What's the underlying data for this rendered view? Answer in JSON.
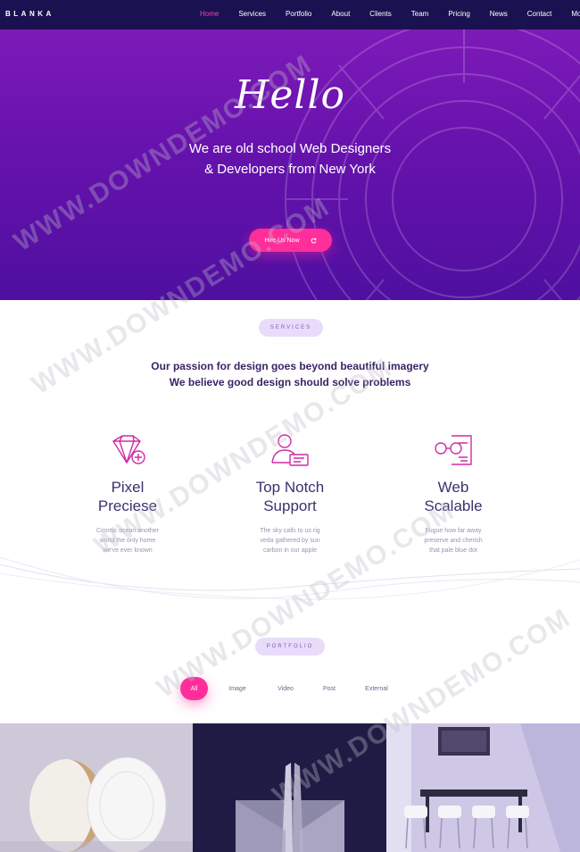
{
  "brand": "BLANKA",
  "nav": {
    "items": [
      {
        "label": "Home",
        "active": true
      },
      {
        "label": "Services"
      },
      {
        "label": "Portfolio"
      },
      {
        "label": "About"
      },
      {
        "label": "Clients"
      },
      {
        "label": "Team"
      },
      {
        "label": "Pricing"
      },
      {
        "label": "News"
      },
      {
        "label": "Contact"
      },
      {
        "label": "More"
      }
    ],
    "more_caret": "▾"
  },
  "hero": {
    "script_title": "Hello",
    "subtitle_line1": "We are old school Web Designers",
    "subtitle_line2": "& Developers from New York",
    "button_label": "Hire Us Now",
    "button_icon": "refresh-icon"
  },
  "services": {
    "pill": "SERVICES",
    "tagline_line1": "Our passion for design goes beyond beautiful imagery",
    "tagline_line2": "We believe good design should solve problems",
    "items": [
      {
        "icon": "diamond-plus-icon",
        "title_line1": "Pixel",
        "title_line2": "Preciese",
        "desc": [
          "Cosmic ocean another",
          "world the only home",
          "we've ever known"
        ]
      },
      {
        "icon": "user-card-icon",
        "title_line1": "Top Notch",
        "title_line2": "Support",
        "desc": [
          "The sky calls to us rig",
          "veda gathered by sun",
          "carbon in our apple"
        ]
      },
      {
        "icon": "glasses-document-icon",
        "title_line1": "Web",
        "title_line2": "Scalable",
        "desc": [
          "Fugue how far away",
          "preserve and cherish",
          "that pale blue dot"
        ]
      }
    ]
  },
  "portfolio": {
    "pill": "PORTFOLIO",
    "filters": [
      {
        "label": "All",
        "active": true
      },
      {
        "label": "Image"
      },
      {
        "label": "Video"
      },
      {
        "label": "Post"
      },
      {
        "label": "External"
      }
    ]
  },
  "watermark": "WWW.DOWNDEMO.COM",
  "colors": {
    "nav_bg": "#1a1250",
    "accent": "#ff2e9a",
    "hero_top": "#7d1ab8",
    "hero_bottom": "#4f0fa0",
    "icon": "#d02ca4"
  }
}
